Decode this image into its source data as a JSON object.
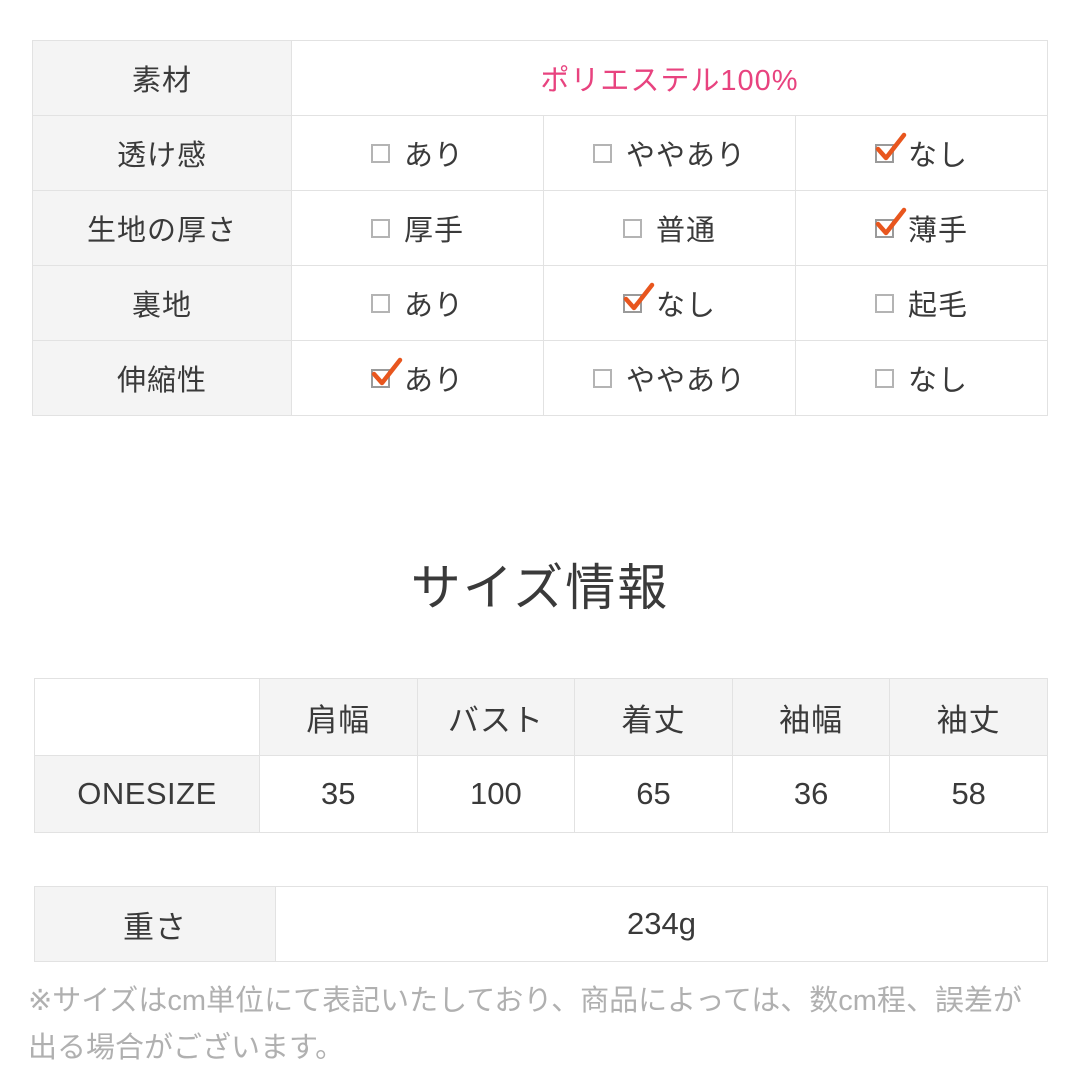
{
  "spec": {
    "material": {
      "label": "素材",
      "value": "ポリエステル100%",
      "value_color": "#e8437f"
    },
    "rows": [
      {
        "label": "透け感",
        "options": [
          {
            "text": "あり",
            "checked": false
          },
          {
            "text": "ややあり",
            "checked": false
          },
          {
            "text": "なし",
            "checked": true
          }
        ]
      },
      {
        "label": "生地の厚さ",
        "options": [
          {
            "text": "厚手",
            "checked": false
          },
          {
            "text": "普通",
            "checked": false
          },
          {
            "text": "薄手",
            "checked": true
          }
        ]
      },
      {
        "label": "裏地",
        "options": [
          {
            "text": "あり",
            "checked": false
          },
          {
            "text": "なし",
            "checked": true
          },
          {
            "text": "起毛",
            "checked": false
          }
        ]
      },
      {
        "label": "伸縮性",
        "options": [
          {
            "text": "あり",
            "checked": true
          },
          {
            "text": "ややあり",
            "checked": false
          },
          {
            "text": "なし",
            "checked": false
          }
        ]
      }
    ],
    "check_color": "#e8561e",
    "box_color": "#b4b4b4"
  },
  "size_section": {
    "heading": "サイズ情報",
    "corner_label": "",
    "columns": [
      "肩幅",
      "バスト",
      "着丈",
      "袖幅",
      "袖丈"
    ],
    "rows": [
      {
        "name": "ONESIZE",
        "values": [
          "35",
          "100",
          "65",
          "36",
          "58"
        ]
      }
    ]
  },
  "weight": {
    "label": "重さ",
    "value": "234g"
  },
  "footnote": {
    "line1": "※サイズはcm単位にて表記いたしており、商品によっては、数cm程、誤差が",
    "line2": "出る場合がございます。"
  }
}
